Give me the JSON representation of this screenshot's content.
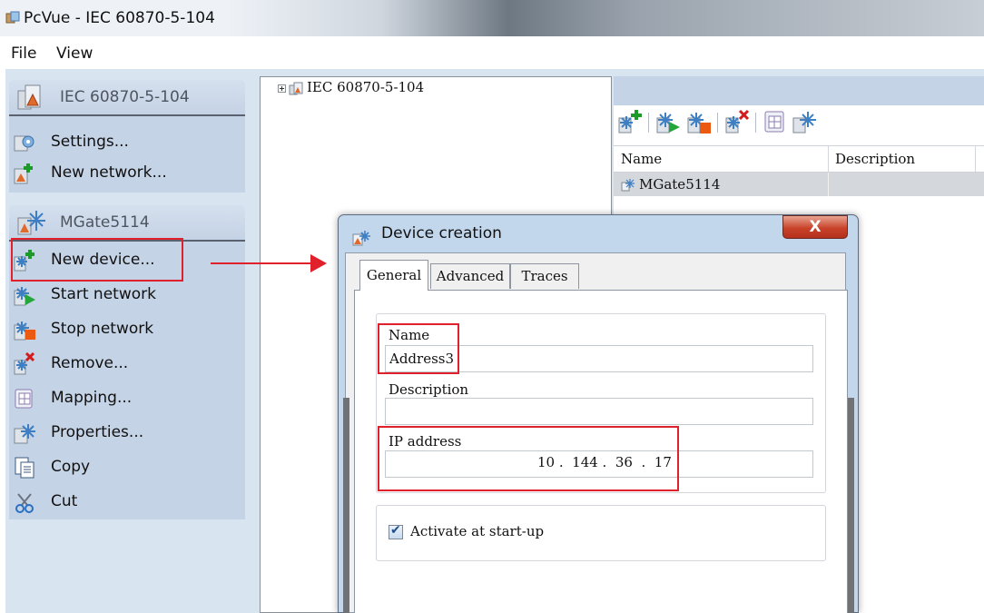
{
  "window": {
    "title": "PcVue - IEC 60870-5-104"
  },
  "menu": {
    "items": [
      "File",
      "View"
    ]
  },
  "tasks": {
    "protocol_group": {
      "title": "IEC 60870-5-104",
      "items": [
        "Settings...",
        "New network..."
      ]
    },
    "network_group": {
      "title": "MGate5114",
      "items": [
        "New device...",
        "Start network",
        "Stop network",
        "Remove...",
        "Mapping...",
        "Properties...",
        "Copy",
        "Cut"
      ]
    }
  },
  "tree": {
    "root_label": "IEC 60870-5-104"
  },
  "device_list": {
    "columns": [
      "Name",
      "Description"
    ],
    "rows": [
      {
        "name": "MGate5114",
        "description": ""
      }
    ]
  },
  "dialog": {
    "title": "Device creation",
    "close_symbol": "X",
    "tabs": [
      "General",
      "Advanced",
      "Traces"
    ],
    "active_tab": "General",
    "fields": {
      "name_label": "Name",
      "name_value": "Address3",
      "description_label": "Description",
      "description_value": "",
      "ip_label": "IP address",
      "ip_value": "10 .  144 .  36  .  17"
    },
    "activate_label": "Activate at start-up",
    "activate_checked": true
  },
  "annotation_color": "#e0202a"
}
